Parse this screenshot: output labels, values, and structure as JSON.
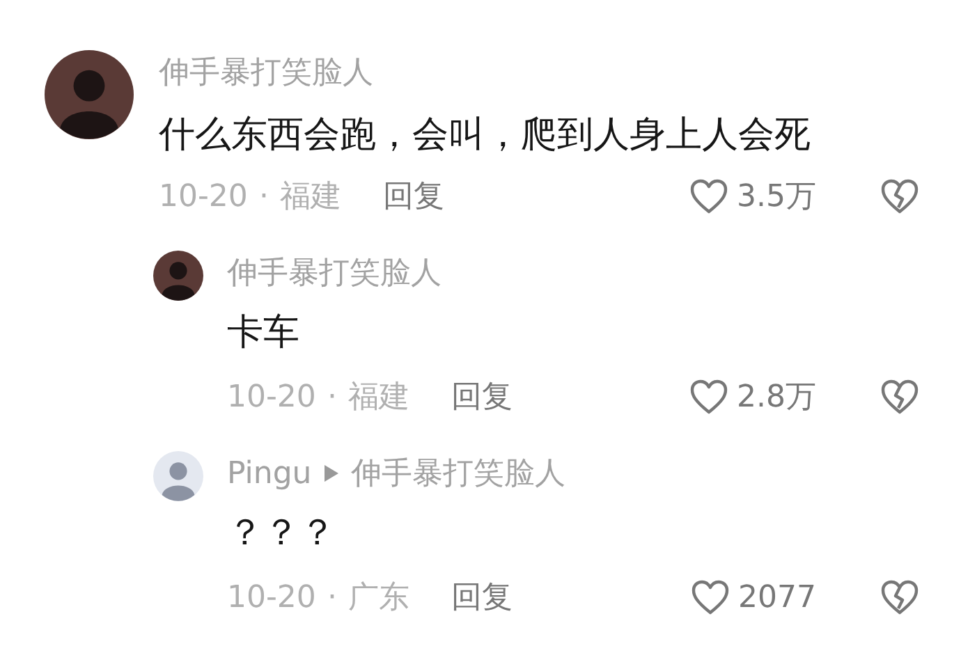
{
  "comments": [
    {
      "avatar": {
        "kind": "dark"
      },
      "author": "伸手暴打笑脸人",
      "text": "什么东西会跑，会叫，爬到人身上人会死",
      "date": "10-20",
      "separator": "·",
      "region": "福建",
      "reply_label": "回复",
      "likes": "3.5万",
      "replies": [
        {
          "avatar": {
            "kind": "dark"
          },
          "author": "伸手暴打笑脸人",
          "text": "卡车",
          "date": "10-20",
          "separator": "·",
          "region": "福建",
          "reply_label": "回复",
          "likes": "2.8万"
        },
        {
          "avatar": {
            "kind": "light"
          },
          "author": "Pingu",
          "reply_to": "伸手暴打笑脸人",
          "text": "？？？",
          "date": "10-20",
          "separator": "·",
          "region": "广东",
          "reply_label": "回复",
          "likes": "2077"
        }
      ]
    }
  ]
}
